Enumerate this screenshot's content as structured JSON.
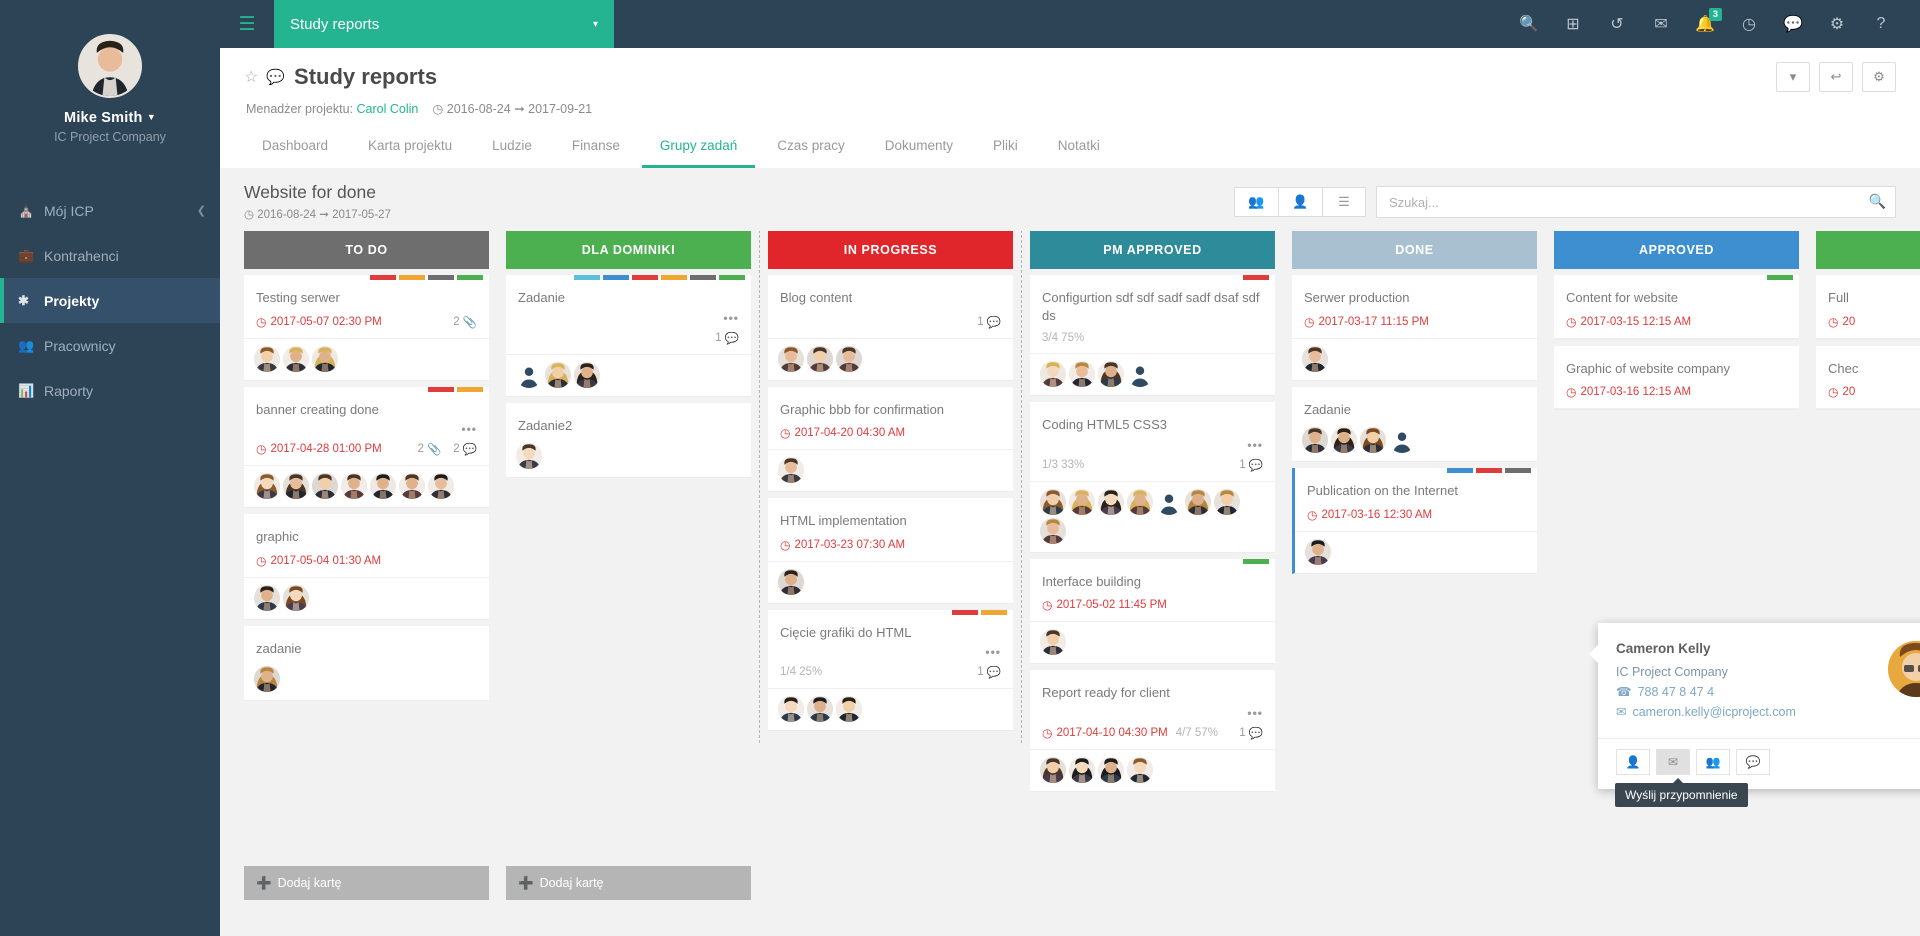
{
  "sidebar": {
    "user_name": "Mike Smith",
    "user_company": "IC Project Company",
    "items": [
      {
        "label": "Mój ICP",
        "icon": "home-icon"
      },
      {
        "label": "Kontrahenci",
        "icon": "briefcase-icon"
      },
      {
        "label": "Projekty",
        "icon": "asterisk-icon"
      },
      {
        "label": "Pracownicy",
        "icon": "people-icon"
      },
      {
        "label": "Raporty",
        "icon": "chart-icon"
      }
    ]
  },
  "topbar": {
    "project_selector": "Study reports",
    "notification_badge": "3",
    "icons": [
      "search-icon",
      "add-icon",
      "history-icon",
      "mail-icon",
      "bell-icon",
      "clock-icon",
      "chat-icon",
      "gear-icon",
      "help-icon"
    ]
  },
  "page": {
    "title": "Study reports",
    "manager_label": "Menadżer projektu:",
    "manager_name": "Carol Colin",
    "date_from": "2016-08-24",
    "date_arrow": "➞",
    "date_to": "2017-09-21",
    "tabs": [
      "Dashboard",
      "Karta projektu",
      "Ludzie",
      "Finanse",
      "Grupy zadań",
      "Czas pracy",
      "Dokumenty",
      "Pliki",
      "Notatki"
    ],
    "active_tab": "Grupy zadań"
  },
  "board": {
    "name": "Website for done",
    "date_from": "2016-08-24",
    "date_to": "2017-05-27",
    "search_placeholder": "Szukaj...",
    "add_card_label": "Dodaj kartę",
    "columns": [
      {
        "title": "TO DO",
        "color": "#6e6e6e",
        "add_card": true,
        "cards": [
          {
            "title": "Testing serwer",
            "labels": [
              "#e03c3c",
              "#f0a732",
              "#6e6e6e",
              "#4caf50"
            ],
            "due": "2017-05-07 02:30 PM",
            "attachments": "2",
            "people": 3
          },
          {
            "title": "banner creating done",
            "labels": [
              "#e03c3c",
              "#f0a732"
            ],
            "due": "2017-04-28 01:00 PM",
            "attachments": "2",
            "comments": "2",
            "dots": true,
            "people": 7
          },
          {
            "title": "graphic",
            "labels": [],
            "due": "2017-05-04 01:30 AM",
            "people": 2
          },
          {
            "title": "zadanie",
            "labels": [],
            "people": 1
          }
        ]
      },
      {
        "title": "DLA DOMINIKI",
        "color": "#4caf50",
        "add_card": true,
        "cards": [
          {
            "title": "Zadanie",
            "labels": [
              "#5bc0de",
              "#3e8fd0",
              "#e03c3c",
              "#f0a732",
              "#6e6e6e",
              "#4caf50"
            ],
            "comments": "1",
            "dots": true,
            "people": 3
          },
          {
            "title": "Zadanie2",
            "labels": [],
            "people": 1
          }
        ]
      },
      {
        "title": "IN PROGRESS",
        "color": "#e0262b",
        "dashed": true,
        "cards": [
          {
            "title": "Blog content",
            "labels": [],
            "comments": "1",
            "people": 3
          },
          {
            "title": "Graphic bbb for confirmation",
            "labels": [],
            "due": "2017-04-20 04:30 AM",
            "people": 1
          },
          {
            "title": "HTML implementation",
            "labels": [],
            "due": "2017-03-23 07:30 AM",
            "people": 1
          },
          {
            "title": "Cięcie grafiki do HTML",
            "labels": [
              "#e03c3c",
              "#f0a732"
            ],
            "progress": "1/4 25%",
            "comments": "1",
            "dots": true,
            "people": 3
          }
        ]
      },
      {
        "title": "PM APPROVED",
        "color": "#2e8b9a",
        "cards": [
          {
            "title": "Configurtion sdf sdf sadf sadf dsaf sdf ds",
            "labels": [
              "#e03c3c"
            ],
            "progress": "3/4 75%",
            "people": 4
          },
          {
            "title": "Coding HTML5 CSS3",
            "labels": [],
            "progress": "1/3 33%",
            "comments": "1",
            "dots": true,
            "people": 8
          },
          {
            "title": "Interface building",
            "labels": [
              "#4caf50"
            ],
            "due": "2017-05-02 11:45 PM",
            "people": 1
          },
          {
            "title": "Report ready for client",
            "labels": [],
            "due": "2017-04-10 04:30 PM",
            "progress": "4/7 57%",
            "comments": "1",
            "dots": true,
            "people": 4
          }
        ]
      },
      {
        "title": "DONE",
        "color": "#a8c0d0",
        "cards": [
          {
            "title": "Serwer production",
            "labels": [],
            "due": "2017-03-17 11:15 PM",
            "people": 1
          },
          {
            "title": "Zadanie",
            "labels": [],
            "people": 4
          },
          {
            "title": "Publication on the Internet",
            "labels": [
              "#3e8fd0",
              "#e03c3c",
              "#6e6e6e"
            ],
            "due": "2017-03-16 12:30 AM",
            "people": 1,
            "left_accent": true
          }
        ]
      },
      {
        "title": "APPROVED",
        "color": "#3e8fd0",
        "cards": [
          {
            "title": "Content for website",
            "labels": [
              "#4caf50"
            ],
            "due": "2017-03-15 12:15 AM"
          },
          {
            "title": "Graphic of website company",
            "labels": [],
            "due": "2017-03-16 12:15 AM"
          }
        ]
      },
      {
        "title": "",
        "color": "#4caf50",
        "cards": [
          {
            "title": "Full ",
            "labels": [],
            "due": "20"
          },
          {
            "title": "Chec",
            "labels": [],
            "due": "20"
          }
        ]
      }
    ]
  },
  "popup": {
    "name": "Cameron Kelly",
    "company": "IC Project Company",
    "phone": "788 47 8 47 4",
    "email": "cameron.kelly@icproject.com",
    "actions": [
      "profile-icon",
      "mail-icon",
      "remove-user-icon",
      "chat-icon"
    ],
    "tooltip": "Wyślij przypomnienie"
  }
}
